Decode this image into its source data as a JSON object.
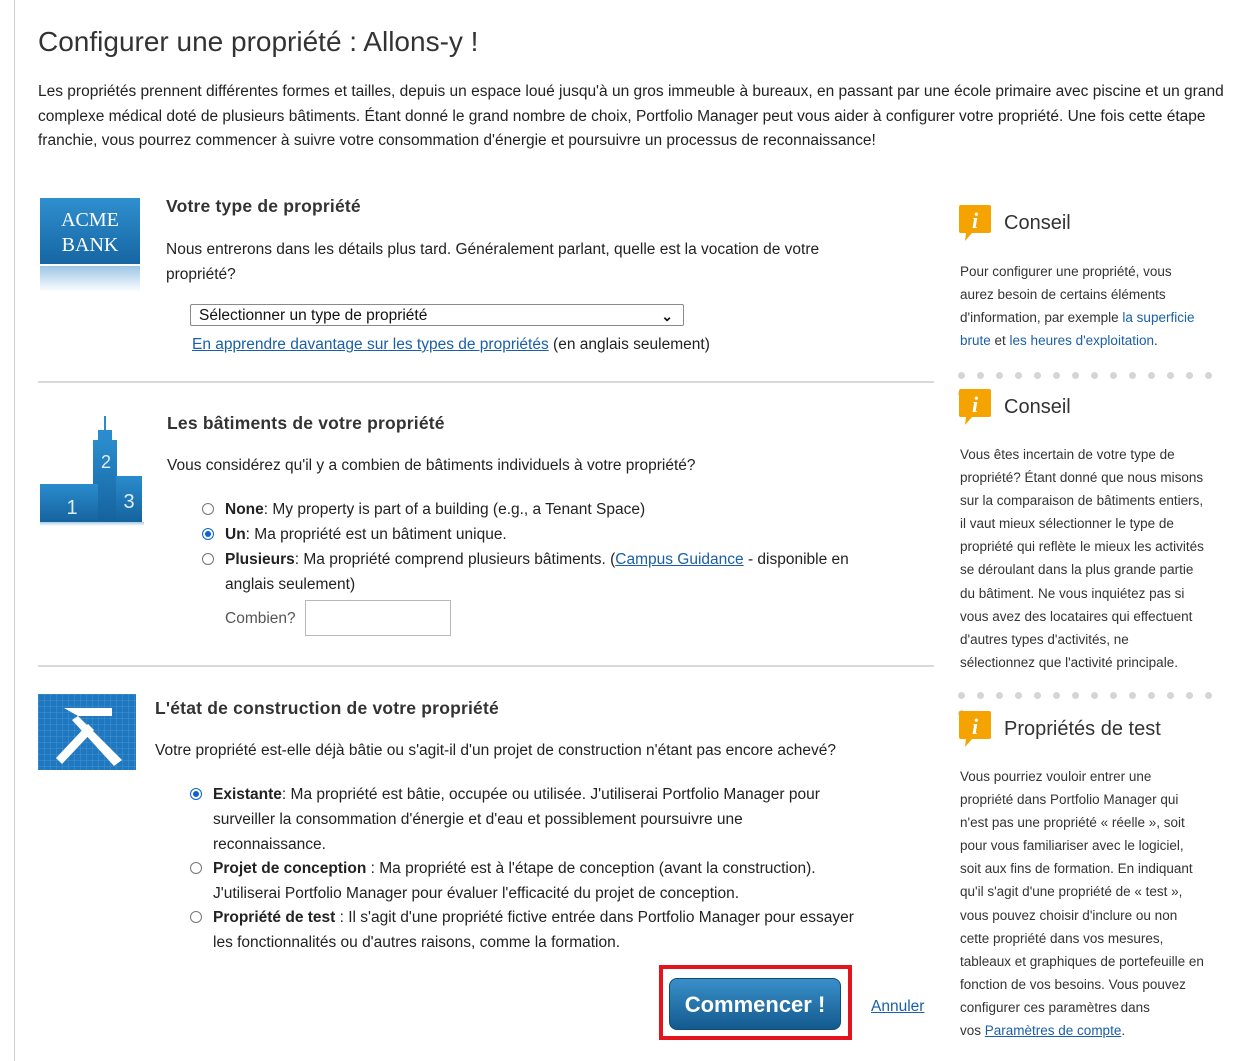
{
  "page": {
    "title": "Configurer une propriété : Allons-y !",
    "intro": "Les propriétés prennent différentes formes et tailles, depuis un espace loué jusqu'à un gros immeuble à bureaux, en passant par une école primaire avec piscine et un grand complexe médical doté de plusieurs bâtiments. Étant donné le grand nombre de choix, Portfolio Manager peut vous aider à configurer votre propriété. Une fois cette étape franchie, vous pourrez commencer à suivre votre consommation d'énergie et poursuivre un processus de reconnaissance!"
  },
  "type_section": {
    "icon_text_line1": "ACME",
    "icon_text_line2": "BANK",
    "heading": "Votre type de propriété",
    "description": "Nous entrerons dans les détails plus tard. Généralement parlant, quelle est la vocation de votre propriété?",
    "select_value": "Sélectionner un type de propriété",
    "learn_link": "En apprendre davantage sur les types de propriétés",
    "learn_suffix": "(en anglais seulement)"
  },
  "buildings_section": {
    "icon_numbers": [
      "1",
      "2",
      "3"
    ],
    "heading": "Les bâtiments de votre propriété",
    "description": "Vous considérez qu'il y a combien de bâtiments individuels à votre propriété?",
    "options": [
      {
        "label": "None",
        "text": ": My property is part of a building (e.g., a Tenant Space)",
        "checked": false
      },
      {
        "label": "Un",
        "text": ": Ma propriété est un bâtiment unique.",
        "checked": true
      },
      {
        "label": "Plusieurs",
        "text": ": Ma propriété comprend plusieurs bâtiments. (",
        "checked": false
      }
    ],
    "campus_link": "Campus Guidance",
    "campus_suffix_1": " - disponible en",
    "campus_suffix_2": "anglais seulement)",
    "count_label": "Combien?",
    "count_value": ""
  },
  "construction_section": {
    "heading": "L'état de construction de votre propriété",
    "description": "Votre propriété est-elle déjà bâtie ou s'agit-il d'un projet de construction n'étant pas encore achevé?",
    "options": [
      {
        "label": "Existante",
        "line1": ": Ma propriété est bâtie, occupée ou utilisée. J'utiliserai Portfolio Manager pour",
        "line2": "surveiller la consommation d'énergie et d'eau et possiblement poursuivre une",
        "line3": "reconnaissance.",
        "checked": true
      },
      {
        "label": "Projet de conception",
        "line1": " : Ma propriété est à l'étape de conception (avant la construction).",
        "line2": "J'utiliserai Portfolio Manager pour évaluer l'efficacité du projet de conception.",
        "line3": "",
        "checked": false
      },
      {
        "label": "Propriété de test",
        "line1": " : Il s'agit d'une propriété fictive entrée dans Portfolio Manager pour essayer",
        "line2": "les fonctionnalités ou d'autres raisons, comme la formation.",
        "line3": "",
        "checked": false
      }
    ]
  },
  "actions": {
    "start_label": "Commencer !",
    "cancel_label": "Annuler"
  },
  "sidebar": {
    "tips": [
      {
        "title": "Conseil",
        "lines": [
          "Pour configurer une propriété, vous",
          "aurez besoin de certains éléments",
          "d'information, par exemple "
        ],
        "link1": "la superficie",
        "link1b": "brute",
        "middle": " et ",
        "link2": "les heures d'exploitation",
        "end": "."
      },
      {
        "title": "Conseil",
        "lines": [
          "Vous êtes incertain de votre type de",
          "propriété? Étant donné que nous misons",
          "sur la comparaison de bâtiments entiers,",
          "il vaut mieux sélectionner le type de",
          "propriété qui reflète le mieux les activités",
          "se déroulant dans la plus grande partie",
          "du bâtiment. Ne vous inquiétez pas si",
          "vous avez des locataires qui effectuent",
          "d'autres types d'activités, ne",
          "sélectionnez que l'activité principale."
        ]
      },
      {
        "title": "Propriétés de test",
        "lines": [
          "Vous pourriez vouloir entrer une",
          "propriété dans Portfolio Manager qui",
          "n'est pas une propriété « réelle », soit",
          "pour vous familiariser avec le logiciel,",
          "soit aux fins de formation. En indiquant",
          "qu'il s'agit d'une propriété de « test »,",
          "vous pouvez choisir d'inclure ou non",
          "cette propriété dans vos mesures,",
          "tableaux et graphiques de portefeuille en",
          "fonction de vos besoins. Vous pouvez",
          "configurer ces paramètres dans",
          "vos "
        ],
        "link": "Paramètres de compte",
        "end": "."
      }
    ]
  },
  "colors": {
    "link": "#1a5fa8",
    "button": "#1f6fa8",
    "highlight_frame": "#e3141b",
    "tip_icon": "#f5a300",
    "radio_checked": "#0b62d6"
  }
}
